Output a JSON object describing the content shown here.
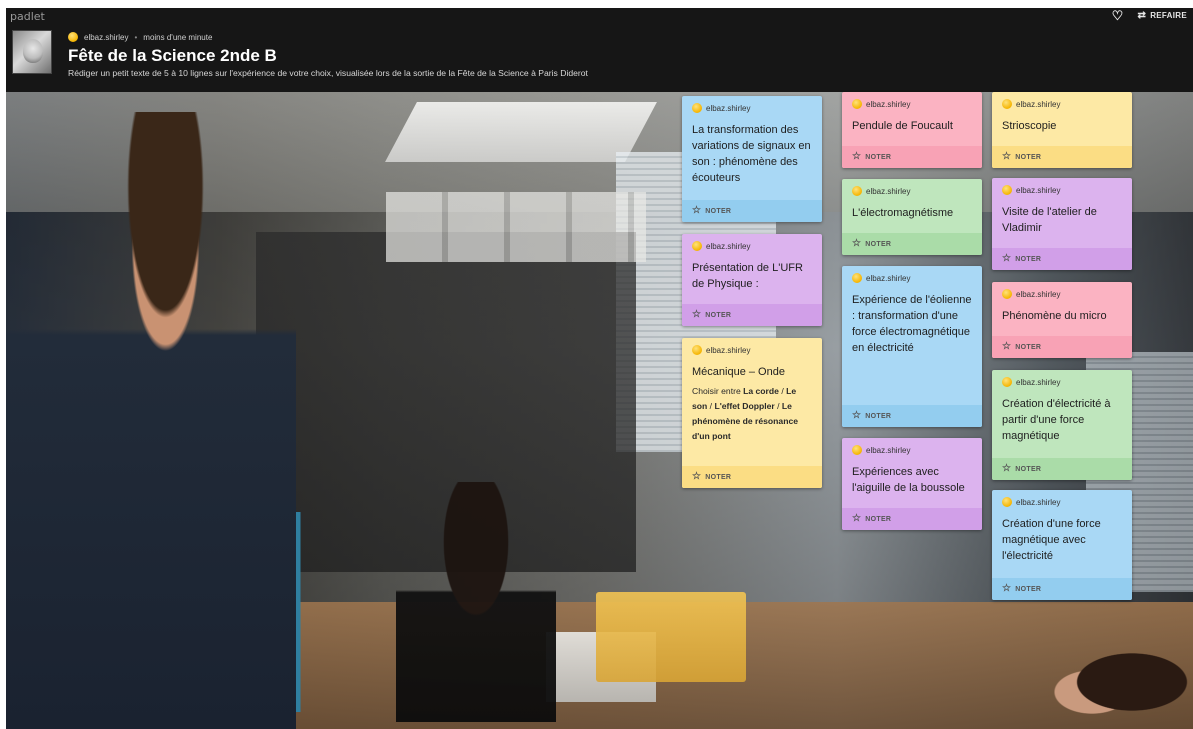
{
  "app": {
    "brand": "padlet",
    "remake_label": "REFAIRE"
  },
  "header": {
    "author": "elbaz.shirley",
    "time": "moins d'une minute",
    "title": "Fête de la Science 2nde B",
    "subtitle": "Rédiger un petit texte de 5 à 10 lignes sur l'expérience de votre choix, visualisée lors de la sortie de la Fête de la Science à Paris Diderot"
  },
  "colors": {
    "blue": "#a9d8f5",
    "pink": "#fbb3c2",
    "yellow": "#fde9a5",
    "green": "#bfe6bd",
    "purple": "#dcb3ee"
  },
  "posts": [
    {
      "author": "elbaz.shirley",
      "title": "La transformation des variations de signaux en son : phénomène des écouteurs",
      "vote": "NOTER"
    },
    {
      "author": "elbaz.shirley",
      "title": "Présentation de L'UFR de Physique :",
      "vote": "NOTER"
    },
    {
      "author": "elbaz.shirley",
      "title": "Mécanique – Onde",
      "text_prefix": "Choisir entre ",
      "text_bold1": "La corde",
      "text_sep1": " / ",
      "text_bold2": "Le son",
      "text_sep2": " / ",
      "text_bold3": "L'effet Doppler",
      "text_sep3": " / ",
      "text_bold4": "Le phénomène de résonance d'un pont",
      "vote": "NOTER"
    },
    {
      "author": "elbaz.shirley",
      "title": "Pendule de Foucault",
      "vote": "NOTER"
    },
    {
      "author": "elbaz.shirley",
      "title": "L'électromagnétisme",
      "vote": "NOTER"
    },
    {
      "author": "elbaz.shirley",
      "title": "Expérience de l'éolienne : transformation d'une force électromagnétique en électricité",
      "vote": "NOTER"
    },
    {
      "author": "elbaz.shirley",
      "title": "Expériences avec l'aiguille de la boussole",
      "vote": "NOTER"
    },
    {
      "author": "elbaz.shirley",
      "title": "Strioscopie",
      "vote": "NOTER"
    },
    {
      "author": "elbaz.shirley",
      "title": "Visite de l'atelier de Vladimir",
      "vote": "NOTER"
    },
    {
      "author": "elbaz.shirley",
      "title": "Phénomène du micro",
      "vote": "NOTER"
    },
    {
      "author": "elbaz.shirley",
      "title": "Création d'électricité à partir d'une force magnétique",
      "vote": "NOTER"
    },
    {
      "author": "elbaz.shirley",
      "title": "Création d'une force magnétique avec l'électricité",
      "vote": "NOTER"
    }
  ]
}
